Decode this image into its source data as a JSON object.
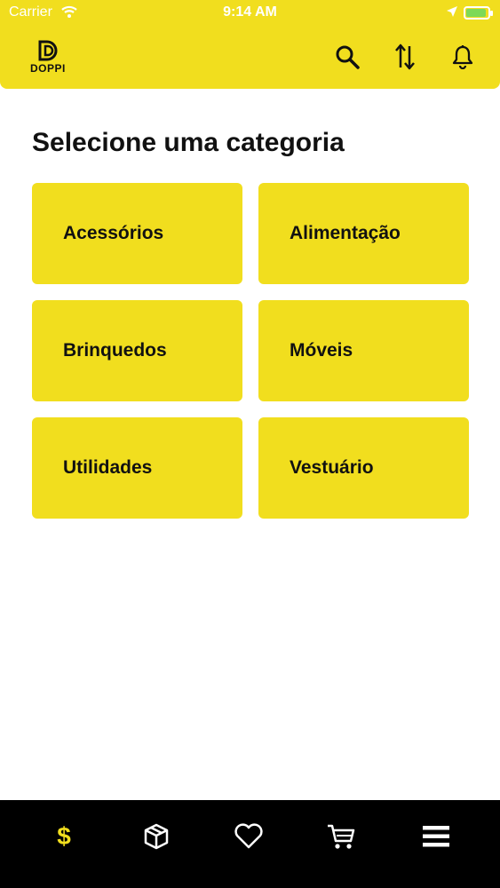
{
  "status_bar": {
    "carrier": "Carrier",
    "time": "9:14 AM"
  },
  "header": {
    "logo_text": "DOPPI"
  },
  "main": {
    "title_regular": "Selecione uma ",
    "title_bold": "categoria",
    "categories": [
      "Acessórios",
      "Alimentação",
      "Brinquedos",
      "Móveis",
      "Utilidades",
      "Vestuário"
    ]
  },
  "tabbar": {
    "active_tab": "dollar",
    "dollar_symbol": "$",
    "items": [
      "dollar-icon",
      "box-icon",
      "heart-icon",
      "cart-icon",
      "menu-icon"
    ]
  },
  "colors": {
    "accent": "#f1de1e",
    "tabbar_bg": "#000000",
    "text": "#111111"
  }
}
